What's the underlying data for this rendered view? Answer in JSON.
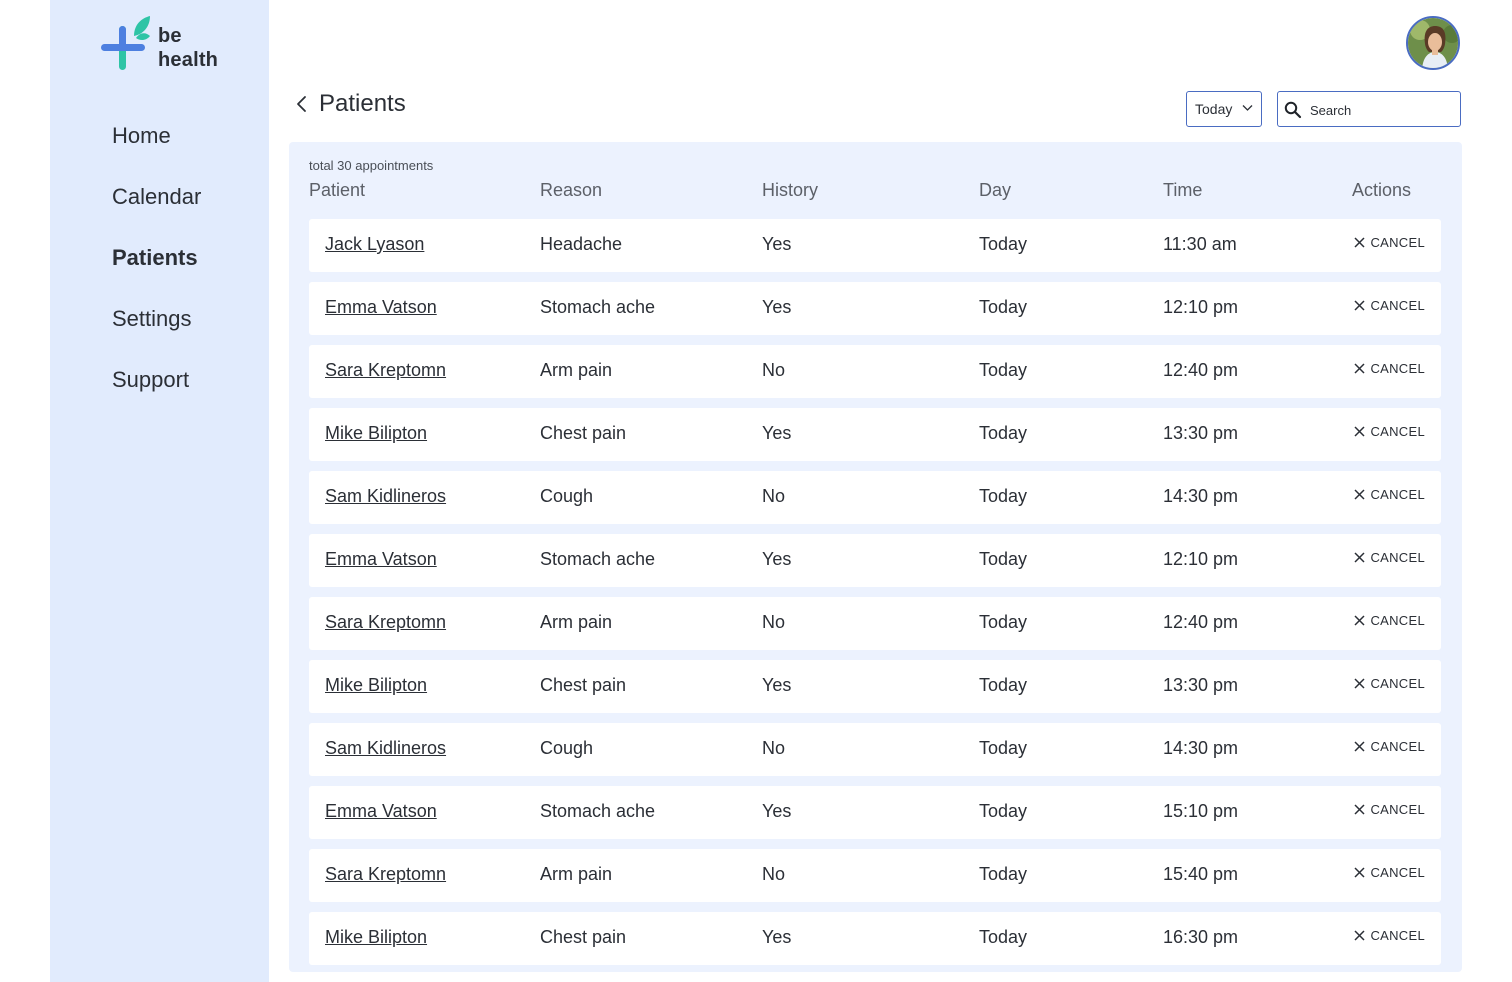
{
  "app": {
    "logo_line1": "be",
    "logo_line2": "health"
  },
  "colors": {
    "sidebar_bg": "#e1ebfd",
    "panel_bg": "#ecf2fe",
    "accent": "#4a6cc2",
    "logo_blue": "#4d7fe0",
    "logo_teal": "#2ec4a6"
  },
  "sidebar": {
    "items": [
      {
        "label": "Home",
        "active": false
      },
      {
        "label": "Calendar",
        "active": false
      },
      {
        "label": "Patients",
        "active": true
      },
      {
        "label": "Settings",
        "active": false
      },
      {
        "label": "Support",
        "active": false
      }
    ]
  },
  "header": {
    "title": "Patients",
    "back_icon": "chevron-left-icon",
    "date_filter": "Today",
    "search_placeholder": "Search"
  },
  "table": {
    "total_label": "total 30 appointments",
    "columns": [
      "Patient",
      "Reason",
      "History",
      "Day",
      "Time",
      "Actions"
    ],
    "cancel_label": "CANCEL",
    "rows": [
      {
        "patient": "Jack Lyason",
        "reason": "Headache",
        "history": "Yes",
        "day": "Today",
        "time": "11:30 am"
      },
      {
        "patient": "Emma Vatson",
        "reason": "Stomach ache",
        "history": "Yes",
        "day": "Today",
        "time": "12:10 pm"
      },
      {
        "patient": "Sara Kreptomn",
        "reason": "Arm pain",
        "history": "No",
        "day": "Today",
        "time": "12:40 pm"
      },
      {
        "patient": "Mike Bilipton",
        "reason": "Chest pain",
        "history": "Yes",
        "day": "Today",
        "time": "13:30 pm"
      },
      {
        "patient": "Sam Kidlineros",
        "reason": "Cough",
        "history": "No",
        "day": "Today",
        "time": "14:30 pm"
      },
      {
        "patient": "Emma Vatson",
        "reason": "Stomach ache",
        "history": "Yes",
        "day": "Today",
        "time": "12:10 pm"
      },
      {
        "patient": "Sara Kreptomn",
        "reason": "Arm pain",
        "history": "No",
        "day": "Today",
        "time": "12:40 pm"
      },
      {
        "patient": "Mike Bilipton",
        "reason": "Chest pain",
        "history": "Yes",
        "day": "Today",
        "time": "13:30 pm"
      },
      {
        "patient": "Sam Kidlineros",
        "reason": "Cough",
        "history": "No",
        "day": "Today",
        "time": "14:30 pm"
      },
      {
        "patient": "Emma Vatson",
        "reason": "Stomach ache",
        "history": "Yes",
        "day": "Today",
        "time": "15:10 pm"
      },
      {
        "patient": "Sara Kreptomn",
        "reason": "Arm pain",
        "history": "No",
        "day": "Today",
        "time": "15:40 pm"
      },
      {
        "patient": "Mike Bilipton",
        "reason": "Chest pain",
        "history": "Yes",
        "day": "Today",
        "time": "16:30 pm"
      }
    ]
  }
}
